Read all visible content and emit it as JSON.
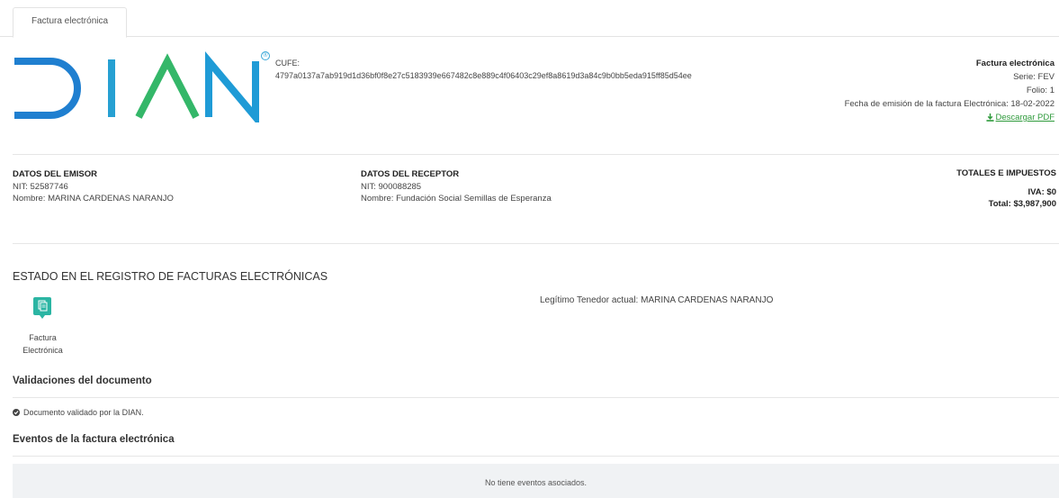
{
  "tab": {
    "label": "Factura electrónica"
  },
  "brand": {
    "logo_text": "DIAN",
    "registered_mark": "®"
  },
  "cufe": {
    "label": "CUFE:",
    "value": "4797a0137a7ab919d1d36bf0f8e27c5183939e667482c8e889c4f06403c29ef8a8619d3a84c9b0bb5eda915ff85d54ee"
  },
  "invoice": {
    "title": "Factura electrónica",
    "serie": "Serie: FEV",
    "folio": "Folio: 1",
    "fecha": "Fecha de emisión de la factura Electrónica: 18-02-2022",
    "download_label": "Descargar PDF"
  },
  "emisor": {
    "heading": "DATOS DEL EMISOR",
    "nit": "NIT: 52587746",
    "nombre": "Nombre: MARINA CARDENAS NARANJO"
  },
  "receptor": {
    "heading": "DATOS DEL RECEPTOR",
    "nit": "NIT: 900088285",
    "nombre": "Nombre: Fundación Social Semillas de Esperanza"
  },
  "totales": {
    "heading": "TOTALES E IMPUESTOS",
    "iva": "IVA: $0",
    "total": "Total: $3,987,900"
  },
  "estado": {
    "heading": "ESTADO EN EL REGISTRO DE FACTURAS ELECTRÓNICAS",
    "icon_label_1": "Factura",
    "icon_label_2": "Electrónica",
    "tenedor": "Legítimo Tenedor actual: MARINA CARDENAS NARANJO"
  },
  "validaciones": {
    "heading": "Validaciones del documento",
    "item": "Documento validado por la DIAN."
  },
  "eventos": {
    "heading": "Eventos de la factura electrónica",
    "empty": "No tiene eventos asociados."
  },
  "colors": {
    "logo_blue": "#1f9bd6",
    "logo_green": "#34b769",
    "link_green": "#2e9a3b",
    "icon_teal": "#2bb5a3"
  }
}
